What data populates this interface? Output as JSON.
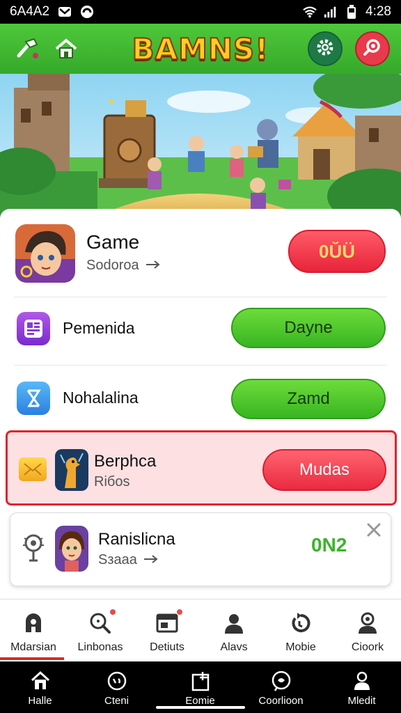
{
  "status_bar": {
    "time_left": "6A4A2",
    "time_right": "4:28"
  },
  "header": {
    "logo": "BAMNS!",
    "settings_icon": "gear-icon",
    "search_icon": "search-icon"
  },
  "rows": [
    {
      "title": "Game",
      "subtitle": "Sodorоa",
      "button": "0ŬÜ"
    },
    {
      "title": "Pemenida",
      "button": "Dayne"
    },
    {
      "title": "Nohalalina",
      "button": "Zamd"
    },
    {
      "title": "Berphca",
      "subtitle": "Riбos",
      "button": "Mudas"
    },
    {
      "title": "Ranislicna",
      "subtitle": "Sзaaa",
      "badge": "0N2"
    }
  ],
  "tabs": [
    {
      "label": "Mdarsian",
      "icon": "home-icon"
    },
    {
      "label": "Linbonas",
      "icon": "search-icon"
    },
    {
      "label": "Detiuts",
      "icon": "window-icon"
    },
    {
      "label": "Alavs",
      "icon": "person-icon"
    },
    {
      "label": "Mobie",
      "icon": "refresh-icon"
    },
    {
      "label": "Cioork",
      "icon": "user-icon"
    }
  ],
  "nav": [
    {
      "label": "Halle",
      "icon": "home-icon"
    },
    {
      "label": "Cteni",
      "icon": "chat-icon"
    },
    {
      "label": "Eomie",
      "icon": "window-icon"
    },
    {
      "label": "Coorlioon",
      "icon": "bubble-icon"
    },
    {
      "label": "Mledit",
      "icon": "person-icon"
    }
  ],
  "colors": {
    "header_green": "#3ab52c",
    "accent_red": "#e8243a",
    "button_green": "#45c22a",
    "highlight_pink": "#fde0e2"
  }
}
